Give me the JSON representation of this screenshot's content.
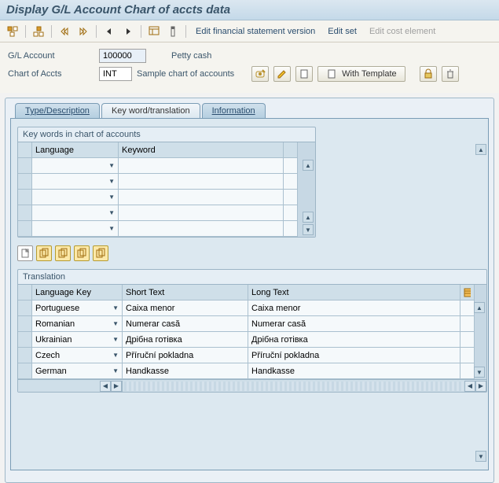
{
  "title": "Display G/L Account Chart of accts data",
  "toolbar_links": {
    "edit_fin": "Edit financial statement version",
    "edit_set": "Edit set",
    "edit_cost": "Edit cost element"
  },
  "form": {
    "gl_label": "G/L Account",
    "gl_value": "100000",
    "gl_desc": "Petty cash",
    "coa_label": "Chart of Accts",
    "coa_value": "INT",
    "coa_desc": "Sample chart of accounts",
    "with_template": "With Template"
  },
  "tabs": [
    {
      "label": "Type/Description",
      "active": false
    },
    {
      "label": "Key word/translation",
      "active": true
    },
    {
      "label": "Information",
      "active": false
    }
  ],
  "keywords_section": {
    "title": "Key words in chart of accounts",
    "columns": {
      "language": "Language",
      "keyword": "Keyword"
    },
    "rows": [
      {
        "language": "",
        "keyword": ""
      },
      {
        "language": "",
        "keyword": ""
      },
      {
        "language": "",
        "keyword": ""
      },
      {
        "language": "",
        "keyword": ""
      },
      {
        "language": "",
        "keyword": ""
      }
    ]
  },
  "translation_section": {
    "title": "Translation",
    "columns": {
      "langkey": "Language Key",
      "short": "Short Text",
      "long": "Long Text"
    },
    "rows": [
      {
        "langkey": "Portuguese",
        "short": "Caixa menor",
        "long": "Caixa menor"
      },
      {
        "langkey": "Romanian",
        "short": "Numerar casă",
        "long": "Numerar casă"
      },
      {
        "langkey": "Ukrainian",
        "short": "Дрібна готівка",
        "long": "Дрібна готівка"
      },
      {
        "langkey": "Czech",
        "short": "Příruční pokladna",
        "long": "Příruční pokladna"
      },
      {
        "langkey": "German",
        "short": "Handkasse",
        "long": "Handkasse"
      }
    ]
  }
}
